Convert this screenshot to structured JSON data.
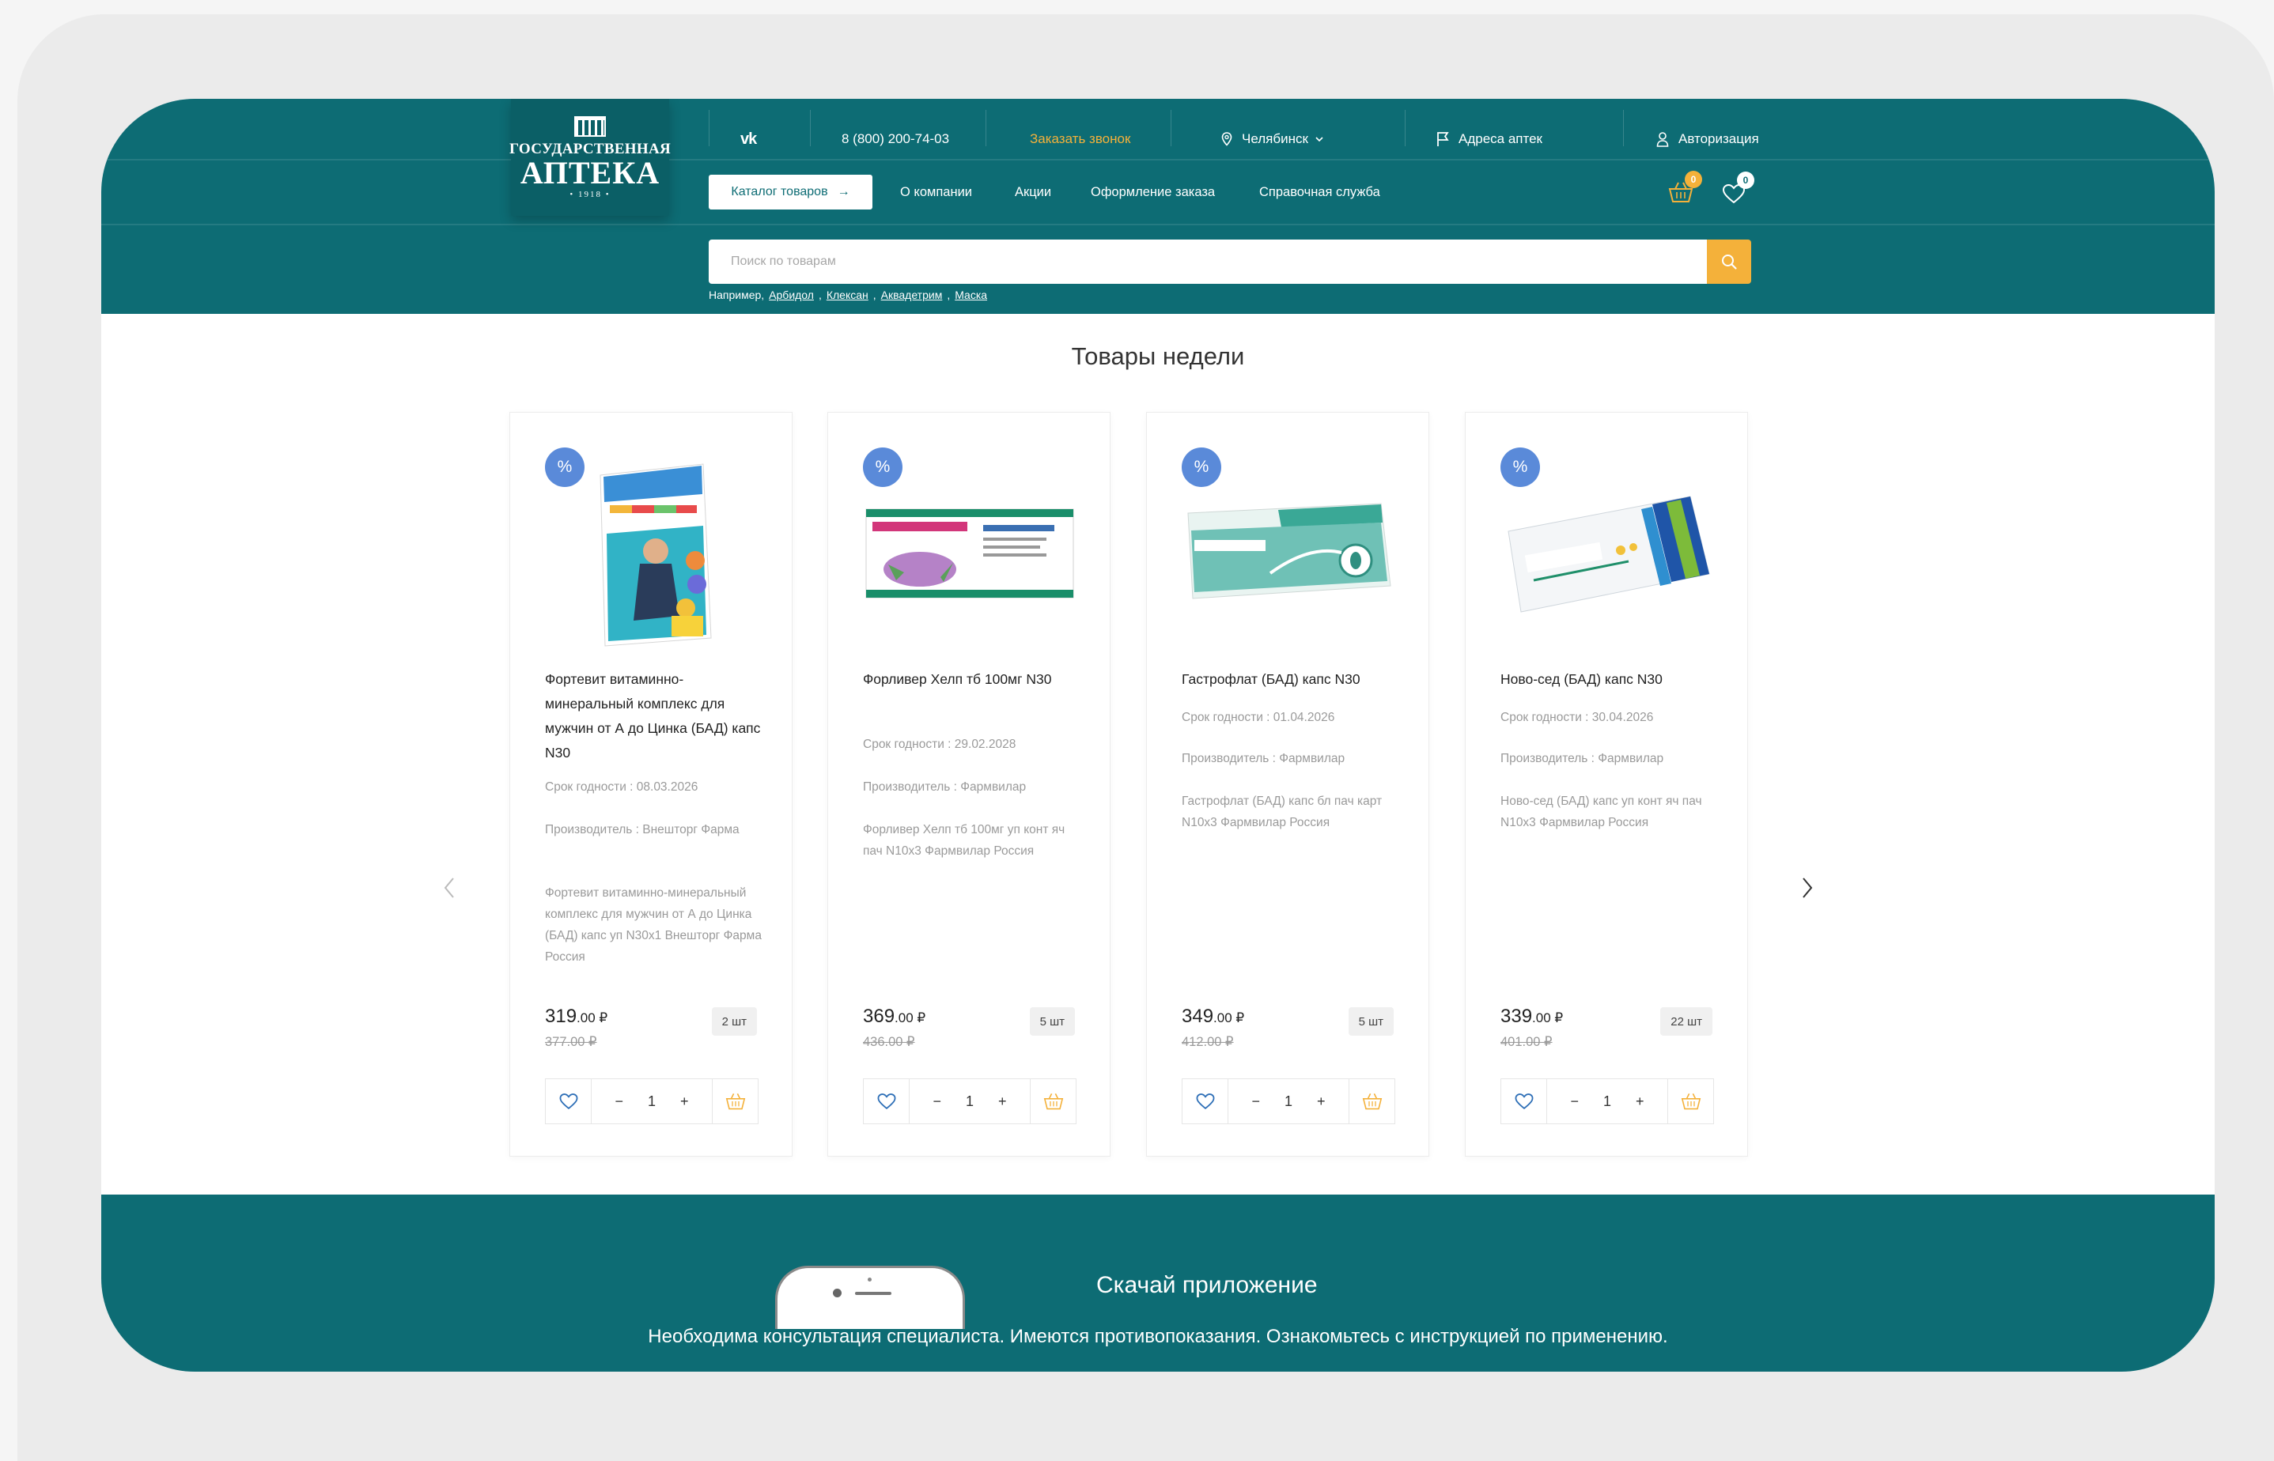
{
  "brand": {
    "logo_top": "ГОСУДАРСТВЕННАЯ",
    "logo_main": "АПТЕКА",
    "logo_year": "• 1918 •"
  },
  "topbar": {
    "vk": "vk",
    "phone": "8 (800) 200-74-03",
    "callback": "Заказать звонок",
    "city": "Челябинск",
    "addresses": "Адреса аптек",
    "auth": "Авторизация"
  },
  "nav": {
    "catalog": "Каталог товаров",
    "items": [
      "О компании",
      "Акции",
      "Оформление заказа",
      "Справочная служба"
    ]
  },
  "header_icons": {
    "cart_count": "0",
    "fav_count": "0"
  },
  "search": {
    "placeholder": "Поиск по товарам",
    "hint_prefix": "Например,",
    "hints": [
      "Арбидол",
      "Клексан",
      "Аквадетрим",
      "Маска"
    ]
  },
  "section_title": "Товары недели",
  "products": [
    {
      "name": "Фортевит витаминно-минеральный комплекс для мужчин от А до Цинка (БАД) капс N30",
      "expiry": "Срок годности : 08.03.2026",
      "maker": "Производитель : Внешторг Фарма",
      "desc": "Фортевит витаминно-минеральный комплекс для мужчин от А до Цинка (БАД) капс уп N30x1 Внешторг Фарма Россия",
      "price": "319",
      "price_cents": ".00 ₽",
      "old_price": "377.00 ₽",
      "stock": "2 шт",
      "qty": "1"
    },
    {
      "name": "Форливер Хелп тб 100мг N30",
      "expiry": "Срок годности : 29.02.2028",
      "maker": "Производитель : Фармвилар",
      "desc": "Форливер Хелп тб 100мг уп конт яч пач N10x3 Фармвилар Россия",
      "price": "369",
      "price_cents": ".00 ₽",
      "old_price": "436.00 ₽",
      "stock": "5 шт",
      "qty": "1"
    },
    {
      "name": "Гастрофлат (БАД) капс N30",
      "expiry": "Срок годности : 01.04.2026",
      "maker": "Производитель : Фармвилар",
      "desc": "Гастрофлат (БАД) капс бл пач карт N10x3 Фармвилар Россия",
      "price": "349",
      "price_cents": ".00 ₽",
      "old_price": "412.00 ₽",
      "stock": "5 шт",
      "qty": "1"
    },
    {
      "name": "Ново-сед (БАД) капс N30",
      "expiry": "Срок годности : 30.04.2026",
      "maker": "Производитель : Фармвилар",
      "desc": "Ново-сед (БАД) капс уп конт яч пач N10x3 Фармвилар Россия",
      "price": "339",
      "price_cents": ".00 ₽",
      "old_price": "401.00 ₽",
      "stock": "22 шт",
      "qty": "1"
    }
  ],
  "discount_badge": "%",
  "stepper": {
    "minus": "−",
    "plus": "+"
  },
  "app_section": {
    "title": "Скачай приложение",
    "disclaimer": "Необходима консультация специалиста. Имеются противопоказания. Ознакомьтесь с инструкцией по применению."
  },
  "colors": {
    "brand_teal": "#0d6c74",
    "accent_orange": "#f4b13a",
    "discount_blue": "#5a8ad9"
  }
}
